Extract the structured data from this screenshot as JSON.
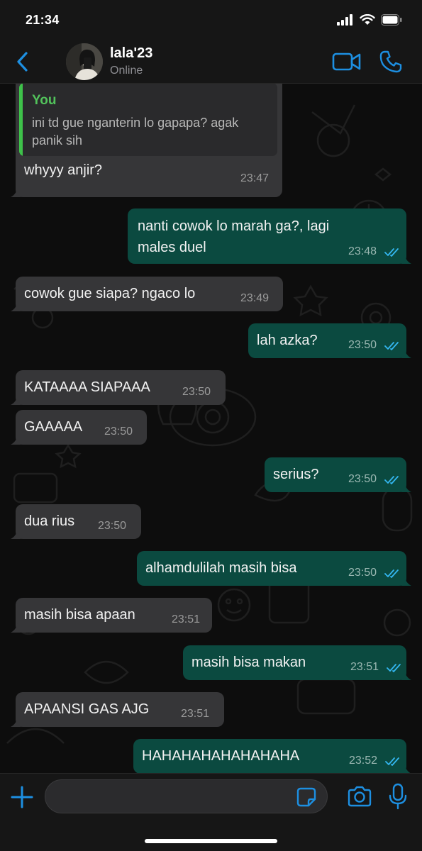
{
  "status_bar": {
    "time": "21:34"
  },
  "header": {
    "contact_name": "lala'23",
    "contact_status": "Online",
    "icons": {
      "back": "chevron-left-icon",
      "video": "video-camera-icon",
      "call": "phone-icon"
    }
  },
  "colors": {
    "accent": "#1d8fe1",
    "incoming": "#363638",
    "outgoing": "#0b4a40",
    "quote_bar": "#3ec24a",
    "read_ticks": "#34b7f1"
  },
  "messages": [
    {
      "dir": "in",
      "quote": {
        "author": "You",
        "text": "ini td gue nganterin lo gapapa? agak panik sih"
      },
      "text": "whyyy anjir?",
      "time": "23:47"
    },
    {
      "dir": "out",
      "text": "nanti cowok lo marah ga?, lagi\nmales duel",
      "time": "23:48",
      "read": true
    },
    {
      "dir": "in",
      "text": "cowok gue siapa? ngaco lo",
      "time": "23:49"
    },
    {
      "dir": "out",
      "text": "lah azka?",
      "time": "23:50",
      "read": true
    },
    {
      "dir": "in",
      "text": "KATAAAA SIAPAAA",
      "time": "23:50"
    },
    {
      "dir": "in",
      "text": "GAAAAA",
      "time": "23:50"
    },
    {
      "dir": "out",
      "text": "serius?",
      "time": "23:50",
      "read": true
    },
    {
      "dir": "in",
      "text": "dua rius",
      "time": "23:50"
    },
    {
      "dir": "out",
      "text": "alhamdulilah masih bisa",
      "time": "23:50",
      "read": true
    },
    {
      "dir": "in",
      "text": "masih bisa apaan",
      "time": "23:51"
    },
    {
      "dir": "out",
      "text": "masih bisa makan",
      "time": "23:51",
      "read": true
    },
    {
      "dir": "in",
      "text": "APAANSI GAS AJG",
      "time": "23:51"
    },
    {
      "dir": "out",
      "text": "HAHAHAHAHAHAHAHA",
      "time": "23:52",
      "read": true
    }
  ],
  "input_bar": {
    "placeholder": "",
    "icons": {
      "add": "plus-icon",
      "sticker": "sticker-icon",
      "camera": "camera-icon",
      "mic": "microphone-icon"
    }
  }
}
